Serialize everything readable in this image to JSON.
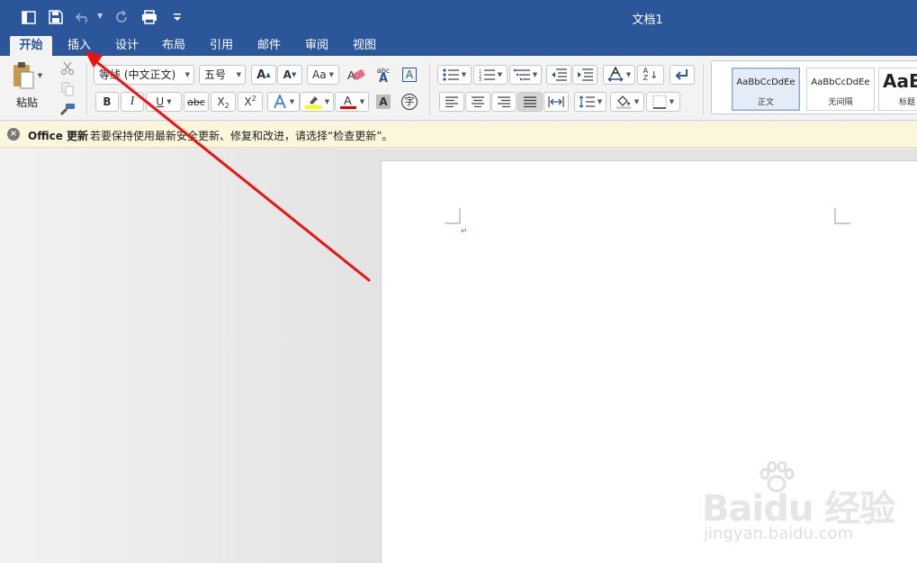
{
  "window": {
    "title": "文档1"
  },
  "tabs": [
    {
      "label": "开始",
      "active": true
    },
    {
      "label": "插入",
      "active": false
    },
    {
      "label": "设计",
      "active": false
    },
    {
      "label": "布局",
      "active": false
    },
    {
      "label": "引用",
      "active": false
    },
    {
      "label": "邮件",
      "active": false
    },
    {
      "label": "审阅",
      "active": false
    },
    {
      "label": "视图",
      "active": false
    }
  ],
  "ribbon": {
    "paste_label": "粘贴",
    "font_name": "等线 (中文正文)",
    "font_size": "五号",
    "bold": "B",
    "italic": "I",
    "underline": "U",
    "strike": "abc",
    "subscript_x": "X",
    "subscript_2": "2",
    "superscript_x": "X",
    "superscript_2": "2",
    "phonetic_top": "abc",
    "phonetic_bottom": "A",
    "border_char": "A",
    "shade_char": "A",
    "enclose_char": "字",
    "sort_top": "A",
    "sort_bottom": "Z",
    "styles": [
      {
        "sample": "AaBbCcDdEe",
        "name": "正文",
        "selected": true
      },
      {
        "sample": "AaBbCcDdEe",
        "name": "无间隔",
        "selected": false
      },
      {
        "sample": "AaB",
        "name": "标题",
        "selected": false
      }
    ]
  },
  "notification": {
    "title": "Office 更新",
    "message": "若要保持使用最新安全更新、修复和改进，请选择“检查更新”。"
  },
  "document": {
    "paragraph_mark": "↵"
  },
  "watermark": {
    "brand": "Baidu 经验",
    "url": "jingyan.baidu.com"
  },
  "colors": {
    "accent": "#2b569a",
    "highlight": "#ffff00",
    "font_color": "#e00000",
    "annotation_arrow": "#ee1111"
  }
}
